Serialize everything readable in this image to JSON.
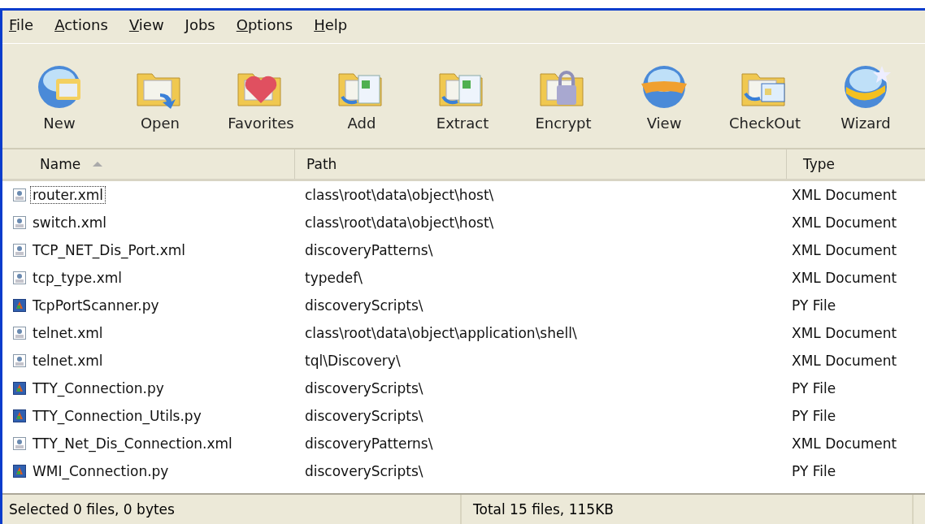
{
  "menu": [
    "File",
    "Actions",
    "View",
    "Jobs",
    "Options",
    "Help"
  ],
  "toolbar": [
    "New",
    "Open",
    "Favorites",
    "Add",
    "Extract",
    "Encrypt",
    "View",
    "CheckOut",
    "Wizard"
  ],
  "table": {
    "columns": [
      {
        "label": "Name",
        "sorted": true
      },
      {
        "label": "Path",
        "sorted": false
      },
      {
        "label": "Type",
        "sorted": false
      }
    ],
    "rows": [
      {
        "kind": "xml",
        "focused": true,
        "name": "router.xml",
        "path": "class\\root\\data\\object\\host\\",
        "type": "XML Document"
      },
      {
        "kind": "xml",
        "focused": false,
        "name": "switch.xml",
        "path": "class\\root\\data\\object\\host\\",
        "type": "XML Document"
      },
      {
        "kind": "xml",
        "focused": false,
        "name": "TCP_NET_Dis_Port.xml",
        "path": "discoveryPatterns\\",
        "type": "XML Document"
      },
      {
        "kind": "xml",
        "focused": false,
        "name": "tcp_type.xml",
        "path": "typedef\\",
        "type": "XML Document"
      },
      {
        "kind": "py",
        "focused": false,
        "name": "TcpPortScanner.py",
        "path": "discoveryScripts\\",
        "type": "PY File"
      },
      {
        "kind": "xml",
        "focused": false,
        "name": "telnet.xml",
        "path": "class\\root\\data\\object\\application\\shell\\",
        "type": "XML Document"
      },
      {
        "kind": "xml",
        "focused": false,
        "name": "telnet.xml",
        "path": "tql\\Discovery\\",
        "type": "XML Document"
      },
      {
        "kind": "py",
        "focused": false,
        "name": "TTY_Connection.py",
        "path": "discoveryScripts\\",
        "type": "PY File"
      },
      {
        "kind": "py",
        "focused": false,
        "name": "TTY_Connection_Utils.py",
        "path": "discoveryScripts\\",
        "type": "PY File"
      },
      {
        "kind": "xml",
        "focused": false,
        "name": "TTY_Net_Dis_Connection.xml",
        "path": "discoveryPatterns\\",
        "type": "XML Document"
      },
      {
        "kind": "py",
        "focused": false,
        "name": "WMI_Connection.py",
        "path": "discoveryScripts\\",
        "type": "PY File"
      }
    ]
  },
  "status_bar": [
    "Selected 0 files, 0 bytes",
    "Total 15 files, 115KB"
  ]
}
